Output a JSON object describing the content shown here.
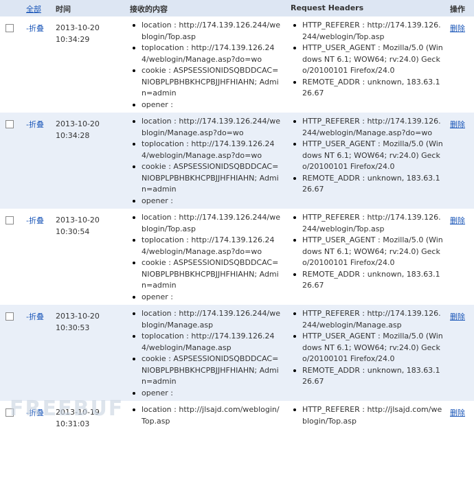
{
  "header": {
    "select_all": "全部",
    "time": "时间",
    "content": "接收的内容",
    "request_headers": "Request Headers",
    "action": "操作"
  },
  "fold_label": "-折叠",
  "delete_label": "删除",
  "watermark": "FREEBUF",
  "rows": [
    {
      "date": "2013-10-20",
      "time": "10:34:29",
      "content": [
        "location : http://174.139.126.244/weblogin/Top.asp",
        "toplocation : http://174.139.126.244/weblogin/Manage.asp?do=wo",
        "cookie : ASPSESSIONIDSQBDDCAC=NIOBPLPBHBKHCPBJJHFHIAHN; Admin=admin",
        "opener :"
      ],
      "headers": [
        "HTTP_REFERER : http://174.139.126.244/weblogin/Top.asp",
        "HTTP_USER_AGENT : Mozilla/5.0 (Windows NT 6.1; WOW64; rv:24.0) Gecko/20100101 Firefox/24.0",
        "REMOTE_ADDR : unknown, 183.63.126.67"
      ]
    },
    {
      "date": "2013-10-20",
      "time": "10:34:28",
      "content": [
        "location : http://174.139.126.244/weblogin/Manage.asp?do=wo",
        "toplocation : http://174.139.126.244/weblogin/Manage.asp?do=wo",
        "cookie : ASPSESSIONIDSQBDDCAC=NIOBPLPBHBKHCPBJJHFHIAHN; Admin=admin",
        "opener :"
      ],
      "headers": [
        "HTTP_REFERER : http://174.139.126.244/weblogin/Manage.asp?do=wo",
        "HTTP_USER_AGENT : Mozilla/5.0 (Windows NT 6.1; WOW64; rv:24.0) Gecko/20100101 Firefox/24.0",
        "REMOTE_ADDR : unknown, 183.63.126.67"
      ]
    },
    {
      "date": "2013-10-20",
      "time": "10:30:54",
      "content": [
        "location : http://174.139.126.244/weblogin/Top.asp",
        "toplocation : http://174.139.126.244/weblogin/Manage.asp?do=wo",
        "cookie : ASPSESSIONIDSQBDDCAC=NIOBPLPBHBKHCPBJJHFHIAHN; Admin=admin",
        "opener :"
      ],
      "headers": [
        "HTTP_REFERER : http://174.139.126.244/weblogin/Top.asp",
        "HTTP_USER_AGENT : Mozilla/5.0 (Windows NT 6.1; WOW64; rv:24.0) Gecko/20100101 Firefox/24.0",
        "REMOTE_ADDR : unknown, 183.63.126.67"
      ]
    },
    {
      "date": "2013-10-20",
      "time": "10:30:53",
      "content": [
        "location : http://174.139.126.244/weblogin/Manage.asp",
        "toplocation : http://174.139.126.244/weblogin/Manage.asp",
        "cookie : ASPSESSIONIDSQBDDCAC=NIOBPLPBHBKHCPBJJHFHIAHN; Admin=admin",
        "opener :"
      ],
      "headers": [
        "HTTP_REFERER : http://174.139.126.244/weblogin/Manage.asp",
        "HTTP_USER_AGENT : Mozilla/5.0 (Windows NT 6.1; WOW64; rv:24.0) Gecko/20100101 Firefox/24.0",
        "REMOTE_ADDR : unknown, 183.63.126.67"
      ]
    },
    {
      "date": "2013-10-19",
      "time": "10:31:03",
      "content": [
        "location : http://jlsajd.com/weblogin/Top.asp"
      ],
      "headers": [
        "HTTP_REFERER : http://jlsajd.com/weblogin/Top.asp"
      ]
    }
  ]
}
